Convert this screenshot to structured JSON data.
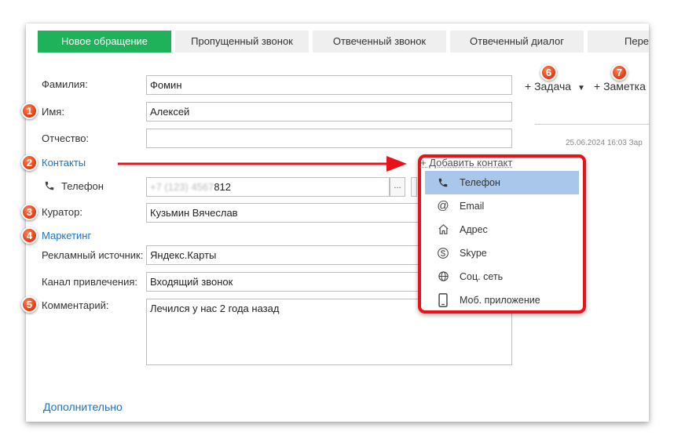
{
  "tabs": [
    {
      "label": "Новое обращение",
      "active": true
    },
    {
      "label": "Пропущенный звонок",
      "active": false
    },
    {
      "label": "Отвеченный звонок",
      "active": false
    },
    {
      "label": "Отвеченный диалог",
      "active": false
    },
    {
      "label": "Пере",
      "active": false
    }
  ],
  "form": {
    "last_name": {
      "label": "Фамилия:",
      "value": "Фомин"
    },
    "first_name": {
      "label": "Имя:",
      "value": "Алексей"
    },
    "middle_name": {
      "label": "Отчество:",
      "value": ""
    },
    "contacts_link": "Контакты",
    "phone": {
      "label": "Телефон",
      "value_masked": "+7 (123) 4567",
      "value_visible": "812",
      "btn": "..."
    },
    "curator": {
      "label": "Куратор:",
      "value": "Кузьмин Вячеслав"
    },
    "marketing_link": "Маркетинг",
    "ad_source": {
      "label": "Рекламный источник:",
      "value": "Яндекс.Карты"
    },
    "channel": {
      "label": "Канал привлечения:",
      "value": "Входящий звонок"
    },
    "comment": {
      "label": "Комментарий:",
      "value": "Лечился у нас 2 года назад"
    },
    "additional_link": "Дополнительно"
  },
  "badges": [
    "1",
    "2",
    "3",
    "4",
    "5",
    "6",
    "7"
  ],
  "actions": {
    "task": "+ Задача",
    "note": "+ Заметка",
    "timestamp": "25.06.2024 16:03 Зар"
  },
  "add_contact": {
    "label": "+ Добавить контакт",
    "items": [
      {
        "label": "Телефон",
        "icon": "phone-icon",
        "selected": true
      },
      {
        "label": "Email",
        "icon": "at-icon",
        "selected": false
      },
      {
        "label": "Адрес",
        "icon": "home-icon",
        "selected": false
      },
      {
        "label": "Skype",
        "icon": "skype-icon",
        "selected": false
      },
      {
        "label": "Соц. сеть",
        "icon": "globe-icon",
        "selected": false
      },
      {
        "label": "Моб. приложение",
        "icon": "mobile-icon",
        "selected": false
      }
    ]
  },
  "colors": {
    "active_tab": "#1fb25a",
    "link": "#1a73c6",
    "highlight": "#e8121b",
    "badge": "#e8461c",
    "selected_item": "#a9c7ea"
  }
}
